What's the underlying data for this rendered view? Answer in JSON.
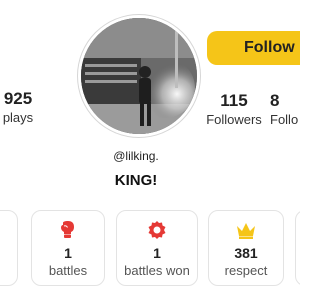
{
  "profile": {
    "handle": "@lilking.",
    "display_name": "KING!"
  },
  "stats": {
    "plays": {
      "value": "925",
      "label": "plays"
    },
    "followers": {
      "value": "115",
      "label": "Followers"
    },
    "following": {
      "value": "8",
      "label": "Follo"
    }
  },
  "follow_button": {
    "label": "Follow"
  },
  "cards": [
    {
      "icon": "partial-icon",
      "value": "",
      "label": "s"
    },
    {
      "icon": "boxing-glove-icon",
      "value": "1",
      "label": "battles"
    },
    {
      "icon": "award-badge-icon",
      "value": "1",
      "label": "battles won"
    },
    {
      "icon": "crown-icon",
      "value": "381",
      "label": "respect"
    },
    {
      "icon": "partial-icon",
      "value": "",
      "label": ""
    }
  ],
  "colors": {
    "accent": "#f5c518",
    "glove": "#e53935",
    "badge": "#e53935",
    "crown": "#f5c518"
  }
}
